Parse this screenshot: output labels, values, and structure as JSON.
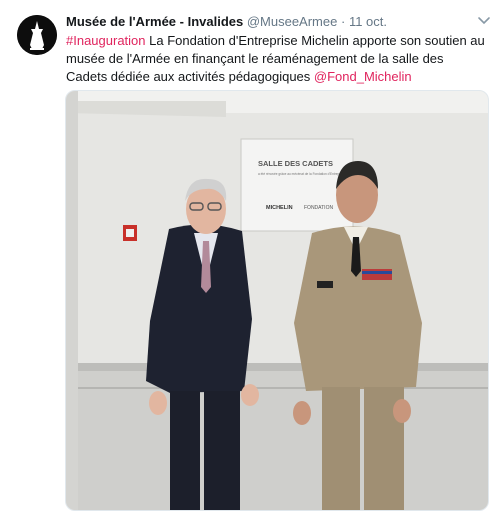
{
  "account": {
    "avatar_icon": "soldier-silhouette-icon",
    "name": "Musée de l'Armée - Invalides",
    "handle": "@MuseeArmee",
    "separator": "·",
    "date": "11 oct."
  },
  "tweet": {
    "hashtag": "#Inauguration",
    "body": " La Fondation d'Entreprise Michelin apporte son soutien au musée de l'Armée en finançant le réaménagement de la salle des Cadets dédiée aux activités pédagogiques ",
    "mention": "@Fond_Michelin",
    "link_color": "#e0245e"
  },
  "media": {
    "plaque": {
      "title": "SALLE DES CADETS",
      "subtitle": "a été rénovée grâce au mécénat de la Fondation d'Entreprise Michelin",
      "brand": "MICHELIN",
      "foundation": "FONDATION"
    }
  },
  "menu_icon": "chevron-down-icon"
}
